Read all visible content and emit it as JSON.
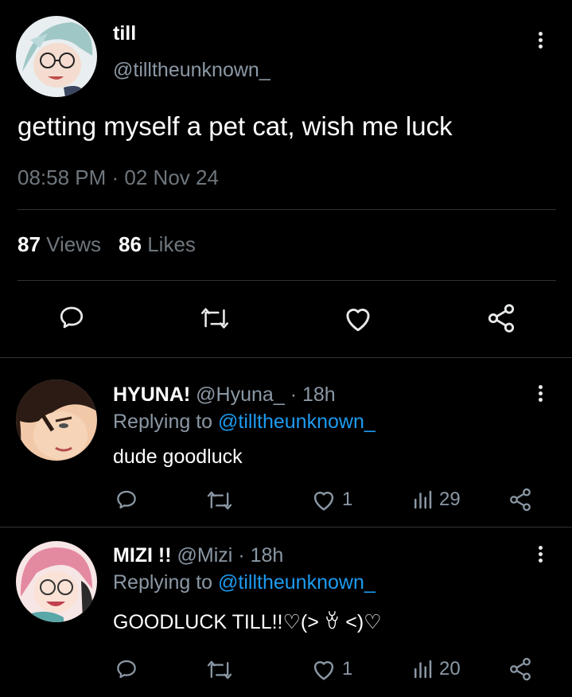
{
  "tweet": {
    "display_name": "till",
    "handle": "@tilltheunknown_",
    "text": "getting myself a pet cat, wish me luck",
    "timestamp": "08:58 PM · 02 Nov 24",
    "views_count": "87",
    "views_label": "Views",
    "likes_count": "86",
    "likes_label": "Likes",
    "avatar_icon": "anime-avatar-teal-hair-glasses",
    "more_icon": "more-vertical-icon"
  },
  "actions": [
    "reply-icon",
    "retweet-icon",
    "like-icon",
    "share-icon"
  ],
  "replies": [
    {
      "display_name": "HYUNA!",
      "handle": "@Hyuna_",
      "separator": "·",
      "time": "18h",
      "replying_prefix": "Replying to",
      "replying_to": "@tilltheunknown_",
      "text": "dude goodluck",
      "likes": "1",
      "views": "29",
      "avatar_icon": "anime-avatar-dark-hair"
    },
    {
      "display_name": "MIZI !!",
      "handle": "@Mizi",
      "separator": "·",
      "time": "18h",
      "replying_prefix": "Replying to",
      "replying_to": "@tilltheunknown_",
      "text": "GOODLUCK TILL!!♡(> ꈊ <)♡",
      "likes": "1",
      "views": "20",
      "avatar_icon": "anime-avatar-pink-hair"
    }
  ],
  "colors": {
    "background": "#000000",
    "text_primary": "#e7e9ea",
    "text_secondary": "#8b98a5",
    "mention": "#1d9bf0",
    "divider": "#2f3336"
  }
}
